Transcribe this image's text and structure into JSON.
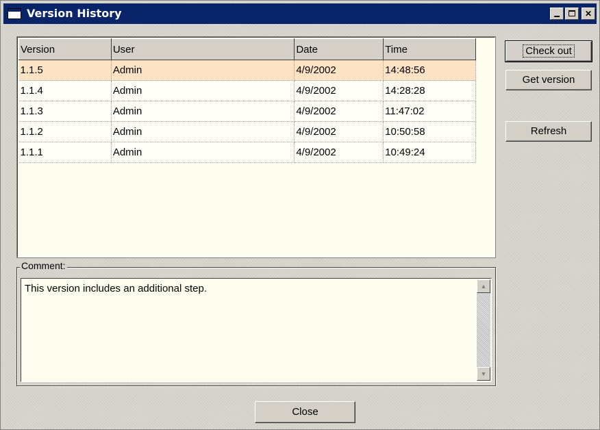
{
  "window": {
    "title": "Version History",
    "icon": "window-icon",
    "controls": [
      "minimize-icon",
      "maximize-icon",
      "close-icon"
    ],
    "colors": {
      "titlebar": "#0a246a",
      "selected_row": "#fde2c3",
      "list_background": "#fefef0"
    }
  },
  "table": {
    "columns": [
      "Version",
      "User",
      "Date",
      "Time"
    ],
    "rows": [
      {
        "version": "1.1.5",
        "user": "Admin",
        "date": "4/9/2002",
        "time": "14:48:56",
        "selected": true
      },
      {
        "version": "1.1.4",
        "user": "Admin",
        "date": "4/9/2002",
        "time": "14:28:28"
      },
      {
        "version": "1.1.3",
        "user": "Admin",
        "date": "4/9/2002",
        "time": "11:47:02"
      },
      {
        "version": "1.1.2",
        "user": "Admin",
        "date": "4/9/2002",
        "time": "10:50:58"
      },
      {
        "version": "1.1.1",
        "user": "Admin",
        "date": "4/9/2002",
        "time": "10:49:24"
      }
    ]
  },
  "buttons": {
    "check_out": "Check out",
    "get_version": "Get version",
    "refresh": "Refresh",
    "close": "Close"
  },
  "comment": {
    "label": "Comment:",
    "text": "This version includes an additional step."
  }
}
